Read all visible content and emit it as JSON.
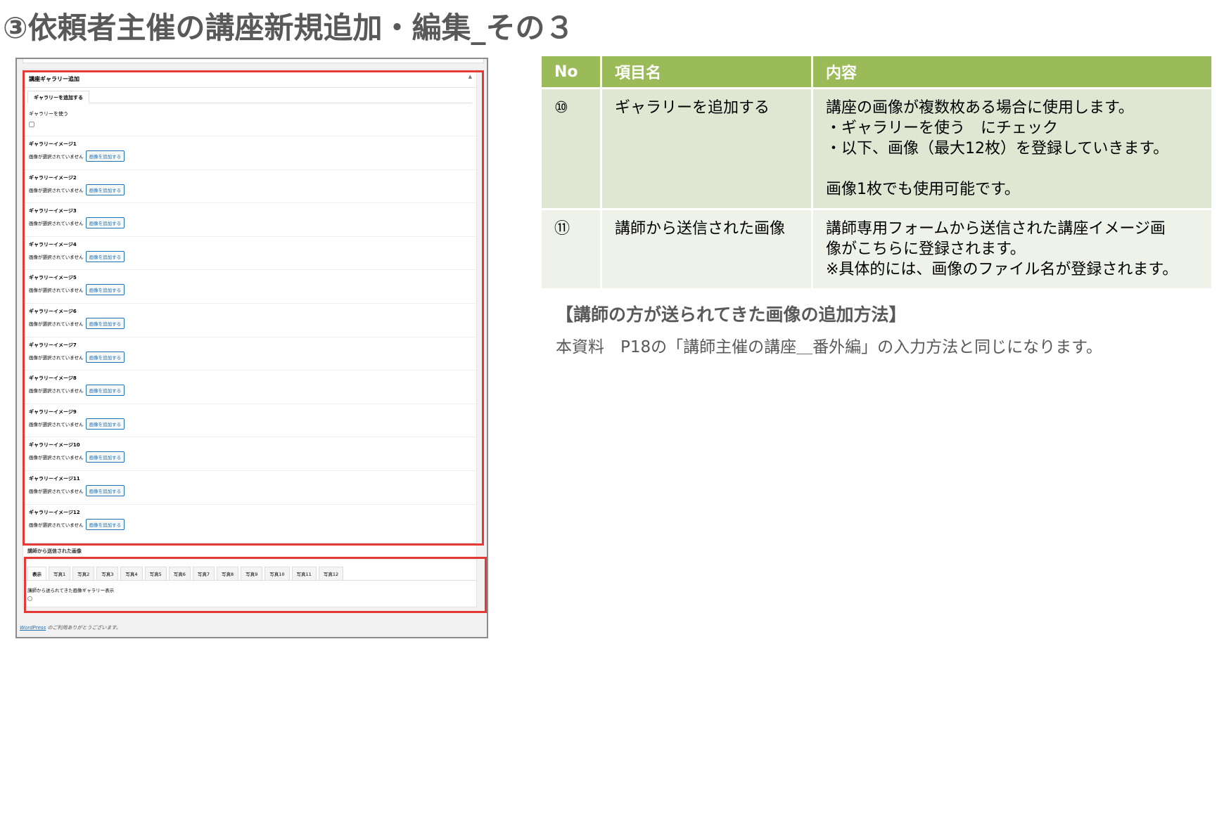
{
  "title": "③依頼者主催の講座新規追加・編集_その３",
  "screenshot": {
    "gallery_box_title": "講座ギャラリー追加",
    "active_tab": "ギャラリーを追加する",
    "use_gallery_label": "ギャラリーを使う",
    "images": [
      {
        "label": "ギャラリーイメージ1",
        "status": "画像が選択されていません",
        "button": "画像を追加する"
      },
      {
        "label": "ギャラリーイメージ2",
        "status": "画像が選択されていません",
        "button": "画像を追加する"
      },
      {
        "label": "ギャラリーイメージ3",
        "status": "画像が選択されていません",
        "button": "画像を追加する"
      },
      {
        "label": "ギャラリーイメージ4",
        "status": "画像が選択されていません",
        "button": "画像を追加する"
      },
      {
        "label": "ギャラリーイメージ5",
        "status": "画像が選択されていません",
        "button": "画像を追加する"
      },
      {
        "label": "ギャラリーイメージ6",
        "status": "画像が選択されていません",
        "button": "画像を追加する"
      },
      {
        "label": "ギャラリーイメージ7",
        "status": "画像が選択されていません",
        "button": "画像を追加する"
      },
      {
        "label": "ギャラリーイメージ8",
        "status": "画像が選択されていません",
        "button": "画像を追加する"
      },
      {
        "label": "ギャラリーイメージ9",
        "status": "画像が選択されていません",
        "button": "画像を追加する"
      },
      {
        "label": "ギャラリーイメージ10",
        "status": "画像が選択されていません",
        "button": "画像を追加する"
      },
      {
        "label": "ギャラリーイメージ11",
        "status": "画像が選択されていません",
        "button": "画像を追加する"
      },
      {
        "label": "ギャラリーイメージ12",
        "status": "画像が選択されていません",
        "button": "画像を追加する"
      }
    ],
    "teacher_box_title": "講師から送信された画像",
    "teacher_tabs": [
      "表示",
      "写真1",
      "写真2",
      "写真3",
      "写真4",
      "写真5",
      "写真6",
      "写真7",
      "写真8",
      "写真9",
      "写真10",
      "写真11",
      "写真12"
    ],
    "teacher_label": "講師から送られてきた画像ギャラリー表示",
    "footer_link": "WordPress",
    "footer_text": " のご利用ありがとうございます。"
  },
  "table": {
    "headers": [
      "No",
      "項目名",
      "内容"
    ],
    "rows": [
      {
        "no": "⑩",
        "name": "ギャラリーを追加する",
        "content": [
          "講座の画像が複数枚ある場合に使用します。",
          "・ギャラリーを使う　にチェック",
          "・以下、画像（最大12枚）を登録していきます。",
          "",
          "画像1枚でも使用可能です。"
        ]
      },
      {
        "no": "⑪",
        "name": "講師から送信された画像",
        "content": [
          "講師専用フォームから送信された講座イメージ画",
          "像がこちらに登録されます。",
          "※具体的には、画像のファイル名が登録されます。"
        ]
      }
    ]
  },
  "note": {
    "title": "【講師の方が送られてきた画像の追加方法】",
    "body": "本資料　P18の「講師主催の講座＿番外編」の入力方法と同じになります。"
  },
  "colors": {
    "header_green": "#9bbb59",
    "row1_bg": "#dfe6d2",
    "row2_bg": "#eff2e9",
    "highlight_red": "#e53935",
    "title_gray": "#595959"
  }
}
